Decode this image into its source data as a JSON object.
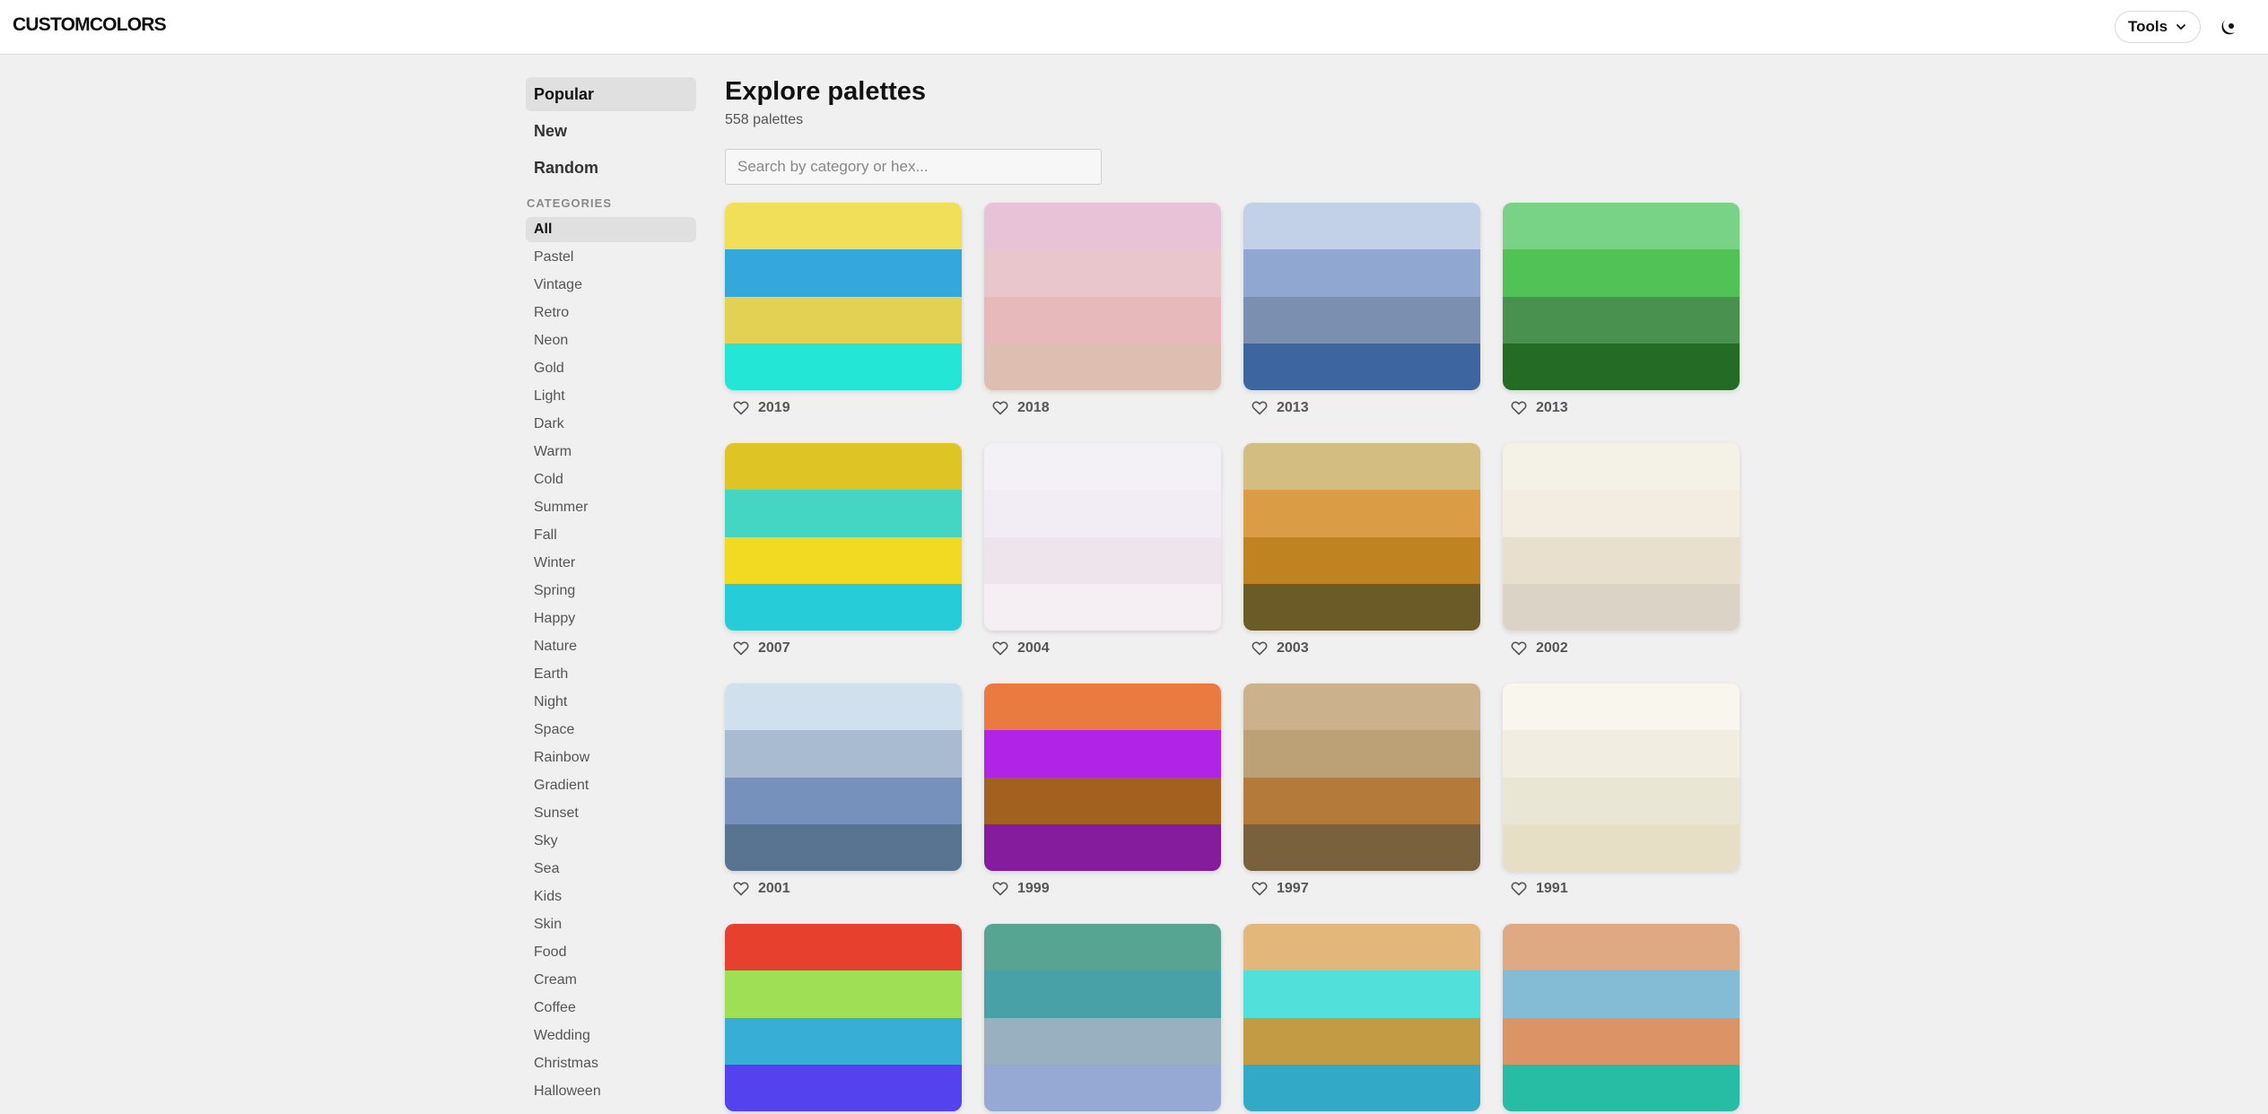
{
  "header": {
    "logo": "CUSTOMCOLORS",
    "tools_label": "Tools"
  },
  "sidebar": {
    "nav": [
      {
        "label": "Popular",
        "active": true
      },
      {
        "label": "New",
        "active": false
      },
      {
        "label": "Random",
        "active": false
      }
    ],
    "categories_heading": "CATEGORIES",
    "categories": [
      "All",
      "Pastel",
      "Vintage",
      "Retro",
      "Neon",
      "Gold",
      "Light",
      "Dark",
      "Warm",
      "Cold",
      "Summer",
      "Fall",
      "Winter",
      "Spring",
      "Happy",
      "Nature",
      "Earth",
      "Night",
      "Space",
      "Rainbow",
      "Gradient",
      "Sunset",
      "Sky",
      "Sea",
      "Kids",
      "Skin",
      "Food",
      "Cream",
      "Coffee",
      "Wedding",
      "Christmas",
      "Halloween"
    ],
    "active_category": "All"
  },
  "main": {
    "title": "Explore palettes",
    "count": "558 palettes",
    "search_placeholder": "Search by category or hex..."
  },
  "palettes": [
    {
      "likes": "2019",
      "colors": [
        "#f2df59",
        "#35a8db",
        "#e2d152",
        "#23e6d6"
      ]
    },
    {
      "likes": "2018",
      "colors": [
        "#e8c3d7",
        "#e8c6cc",
        "#e8b9bb",
        "#ddbeb0"
      ]
    },
    {
      "likes": "2013",
      "colors": [
        "#c2d1e8",
        "#90a7d1",
        "#7b8fb0",
        "#3d66a0"
      ]
    },
    {
      "likes": "2013",
      "colors": [
        "#79d387",
        "#51c256",
        "#48914e",
        "#246b26"
      ]
    },
    {
      "likes": "2007",
      "colors": [
        "#dfc426",
        "#44d6c3",
        "#f2d922",
        "#26cdd8"
      ]
    },
    {
      "likes": "2004",
      "colors": [
        "#f3f1f6",
        "#f2edf4",
        "#eee5ec",
        "#f5eef2"
      ]
    },
    {
      "likes": "2003",
      "colors": [
        "#d3bd80",
        "#da9d45",
        "#bf8322",
        "#6b5c27"
      ]
    },
    {
      "likes": "2002",
      "colors": [
        "#f4f1e6",
        "#f2ece1",
        "#e9dfcd",
        "#dbd3c5"
      ]
    },
    {
      "likes": "2001",
      "colors": [
        "#d0e0ec",
        "#a9bbd0",
        "#7691bb",
        "#587491"
      ]
    },
    {
      "likes": "1999",
      "colors": [
        "#eb7a40",
        "#b223e8",
        "#a2611f",
        "#851c9d"
      ]
    },
    {
      "likes": "1997",
      "colors": [
        "#cbb18c",
        "#bda176",
        "#b47a3a",
        "#7a613d"
      ]
    },
    {
      "likes": "1991",
      "colors": [
        "#f9f6ee",
        "#f1ede1",
        "#e9e6d5",
        "#e6dfc6"
      ]
    },
    {
      "likes": "",
      "colors": [
        "#e7402f",
        "#9edf55",
        "#37aed5",
        "#5442ee"
      ]
    },
    {
      "likes": "",
      "colors": [
        "#57a493",
        "#48a1a7",
        "#98b0bf",
        "#96a9d4"
      ]
    },
    {
      "likes": "",
      "colors": [
        "#e3b77b",
        "#52e0db",
        "#c39b44",
        "#32a9c6"
      ]
    },
    {
      "likes": "",
      "colors": [
        "#dfaa83",
        "#85bcd5",
        "#dc9366",
        "#26bda4"
      ]
    }
  ]
}
